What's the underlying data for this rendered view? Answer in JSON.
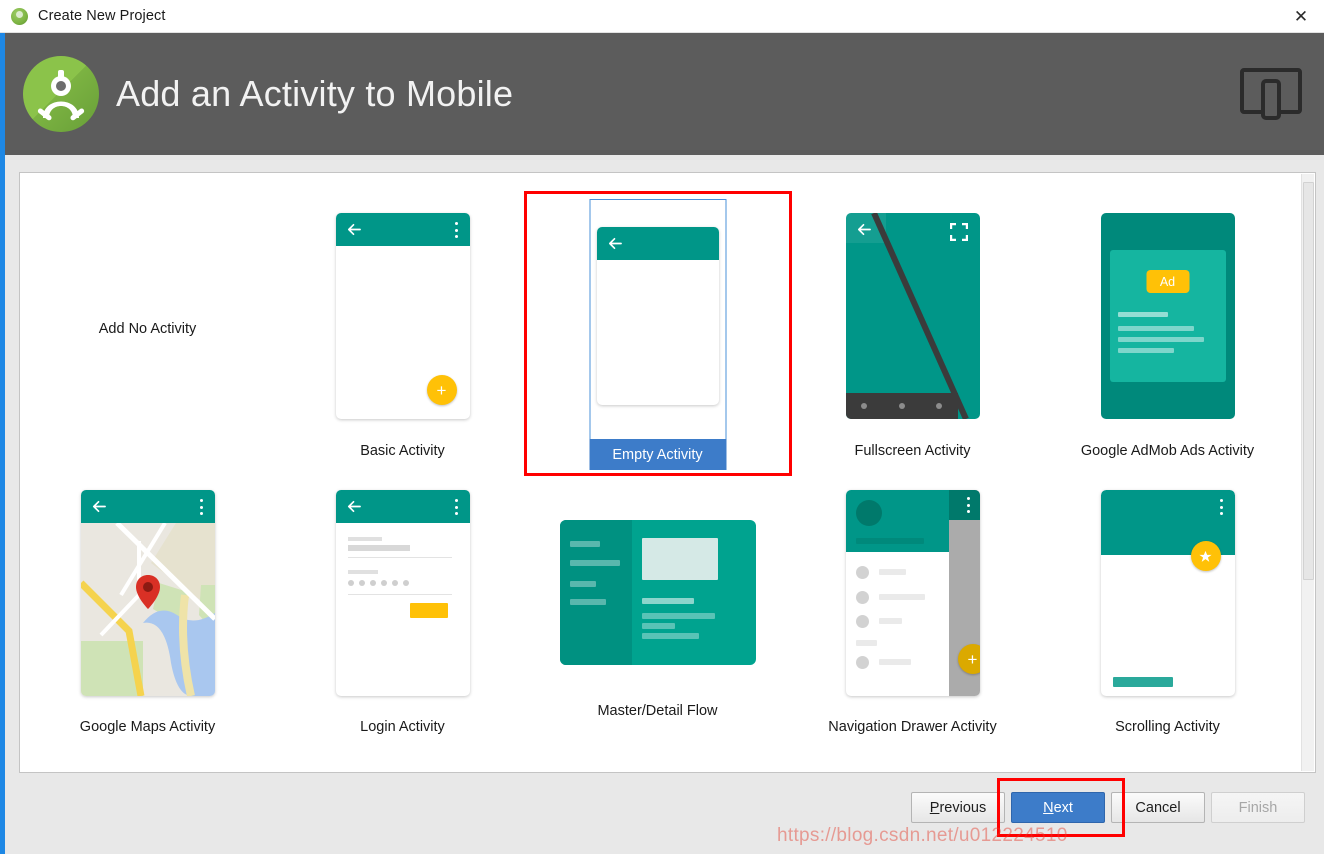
{
  "window": {
    "title": "Create New Project",
    "app_icon": "android-studio-icon",
    "close_icon": "close-icon"
  },
  "wizard": {
    "header_title": "Add an Activity to Mobile",
    "logo_icon": "android-studio-logo",
    "form_factor_icon": "mobile-device-icon",
    "colors": {
      "header_bg": "#5c5c5c",
      "accent_blue": "#1e88e5",
      "selection_blue": "#3d7cc9",
      "material_teal": "#009688",
      "material_amber": "#ffc107",
      "annotation_red": "#ff0000"
    }
  },
  "gallery": {
    "templates": [
      {
        "id": "none",
        "label": "Add No Activity",
        "thumbnail": "no-thumbnail",
        "selected": false
      },
      {
        "id": "basic",
        "label": "Basic Activity",
        "thumbnail": "basic-activity-thumbnail",
        "selected": false
      },
      {
        "id": "empty",
        "label": "Empty Activity",
        "thumbnail": "empty-activity-thumbnail",
        "selected": true
      },
      {
        "id": "fullscreen",
        "label": "Fullscreen Activity",
        "thumbnail": "fullscreen-activity-thumbnail",
        "selected": false
      },
      {
        "id": "admob",
        "label": "Google AdMob Ads Activity",
        "thumbnail": "admob-activity-thumbnail",
        "selected": false
      },
      {
        "id": "maps",
        "label": "Google Maps Activity",
        "thumbnail": "maps-activity-thumbnail",
        "selected": false
      },
      {
        "id": "login",
        "label": "Login Activity",
        "thumbnail": "login-activity-thumbnail",
        "selected": false
      },
      {
        "id": "masterdetail",
        "label": "Master/Detail Flow",
        "thumbnail": "master-detail-thumbnail",
        "selected": false
      },
      {
        "id": "navdrawer",
        "label": "Navigation Drawer Activity",
        "thumbnail": "nav-drawer-thumbnail",
        "selected": false
      },
      {
        "id": "scrolling",
        "label": "Scrolling Activity",
        "thumbnail": "scrolling-activity-thumbnail",
        "selected": false
      }
    ],
    "admob_badge_text": "Ad",
    "scrollbar": {
      "visible": true
    }
  },
  "footer": {
    "buttons": [
      {
        "id": "previous",
        "label": "Previous",
        "mnemonic": "P",
        "state": "enabled"
      },
      {
        "id": "next",
        "label": "Next",
        "mnemonic": "N",
        "state": "default"
      },
      {
        "id": "cancel",
        "label": "Cancel",
        "mnemonic": "",
        "state": "enabled"
      },
      {
        "id": "finish",
        "label": "Finish",
        "mnemonic": "",
        "state": "disabled"
      }
    ],
    "labels": {
      "previous_head": "P",
      "previous_tail": "revious",
      "next_head": "N",
      "next_tail": "ext",
      "cancel": "Cancel",
      "finish": "Finish"
    }
  },
  "watermark": {
    "text": "https://blog.csdn.net/u012224510"
  }
}
